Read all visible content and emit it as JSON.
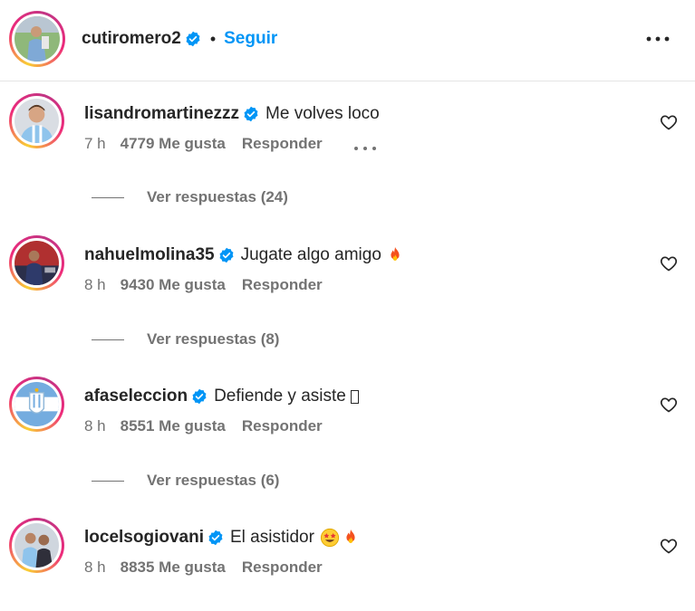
{
  "post_header": {
    "username": "cutiromero2",
    "separator": "•",
    "follow_label": "Seguir",
    "more_icon": "more-horizontal-icon"
  },
  "colors": {
    "link_blue": "#0095f6",
    "verified_blue": "#0095f6",
    "text_primary": "#262626",
    "text_secondary": "#737373"
  },
  "comments": [
    {
      "username": "lisandromartinezzz",
      "verified": true,
      "text": "Me volves loco",
      "time": "7 h",
      "likes": "4779 Me gusta",
      "reply_label": "Responder",
      "has_more_menu": true,
      "replies_label": "Ver respuestas (24)"
    },
    {
      "username": "nahuelmolina35",
      "verified": true,
      "text": "Jugate algo amigo",
      "emojis": [
        "fire-emoji"
      ],
      "time": "8 h",
      "likes": "9430 Me gusta",
      "reply_label": "Responder",
      "replies_label": "Ver respuestas (8)"
    },
    {
      "username": "afaseleccion",
      "verified": true,
      "text": "Defiende y asiste",
      "emojis": [
        "missing-glyph-box"
      ],
      "time": "8 h",
      "likes": "8551 Me gusta",
      "reply_label": "Responder",
      "replies_label": "Ver respuestas (6)"
    },
    {
      "username": "locelsogiovani",
      "verified": true,
      "text": "El asistidor",
      "emojis": [
        "star-struck-emoji",
        "fire-emoji"
      ],
      "time": "8 h",
      "likes": "8835 Me gusta",
      "reply_label": "Responder"
    }
  ]
}
